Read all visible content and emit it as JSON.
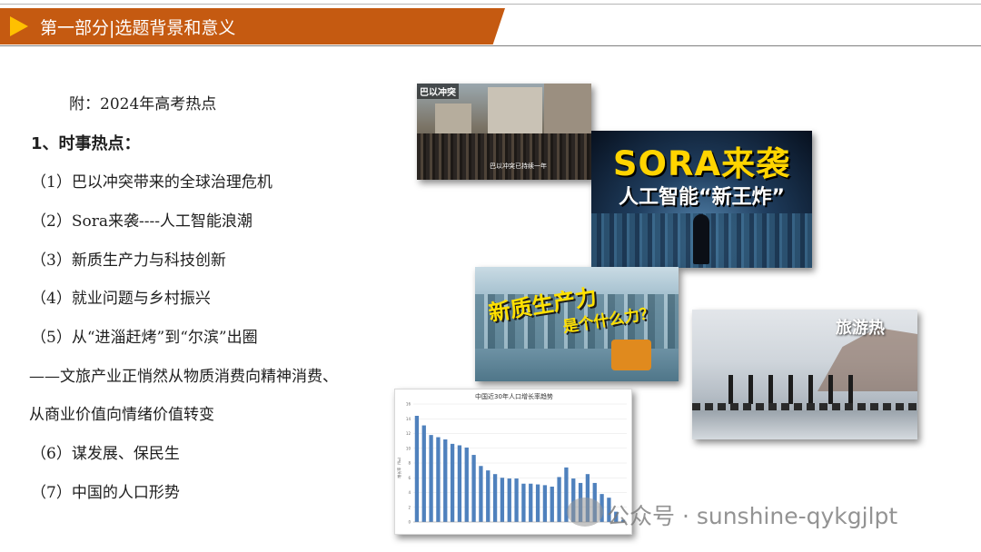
{
  "header": {
    "title": "第一部分|选题背景和意义"
  },
  "content": {
    "appendix": "附：2024年高考热点",
    "section_heading": "1、时事热点：",
    "items": [
      "（1）巴以冲突带来的全球治理危机",
      "（2）Sora来袭----人工智能浪潮",
      "（3）新质生产力与科技创新",
      "（4）就业问题与乡村振兴",
      "（5）从“进淄赶烤”到“尔滨”出圈",
      "——文旅产业正悄然从物质消费向精神消费、",
      "从商业价值向情绪价值转变",
      "（6）谋发展、保民生",
      "（7）中国的人口形势"
    ]
  },
  "images": {
    "conflict": {
      "tag": "巴以冲突",
      "caption": "巴以冲突已持续一年"
    },
    "sora": {
      "title": "SORA来袭",
      "subtitle": "人工智能“新王炸”"
    },
    "productivity": {
      "line1": "新质生产力",
      "line2": "是个什么力？"
    },
    "tourism": {
      "label": "旅游热"
    }
  },
  "chart_data": {
    "type": "bar",
    "title": "中国近30年人口增长率趋势",
    "ylabel": "增长率（‰）",
    "ylim": [
      0,
      16
    ],
    "yticks": [
      0,
      2,
      4,
      6,
      8,
      10,
      12,
      14,
      16
    ],
    "values": [
      14.4,
      13.1,
      11.8,
      11.5,
      11.2,
      10.6,
      10.4,
      10.1,
      9.1,
      7.6,
      7.0,
      6.5,
      6.0,
      5.9,
      5.9,
      5.2,
      5.2,
      5.1,
      5.0,
      4.8,
      6.1,
      7.4,
      5.9,
      5.3,
      6.5,
      5.3,
      3.8,
      3.3,
      1.4,
      0.3
    ],
    "bar_color": "#4f81bd",
    "grid": true
  },
  "watermark": {
    "text": "公众号 · sunshine-qykgjlpt"
  },
  "colors": {
    "header_band": "#c55a11",
    "header_arrow": "#ffc000"
  }
}
